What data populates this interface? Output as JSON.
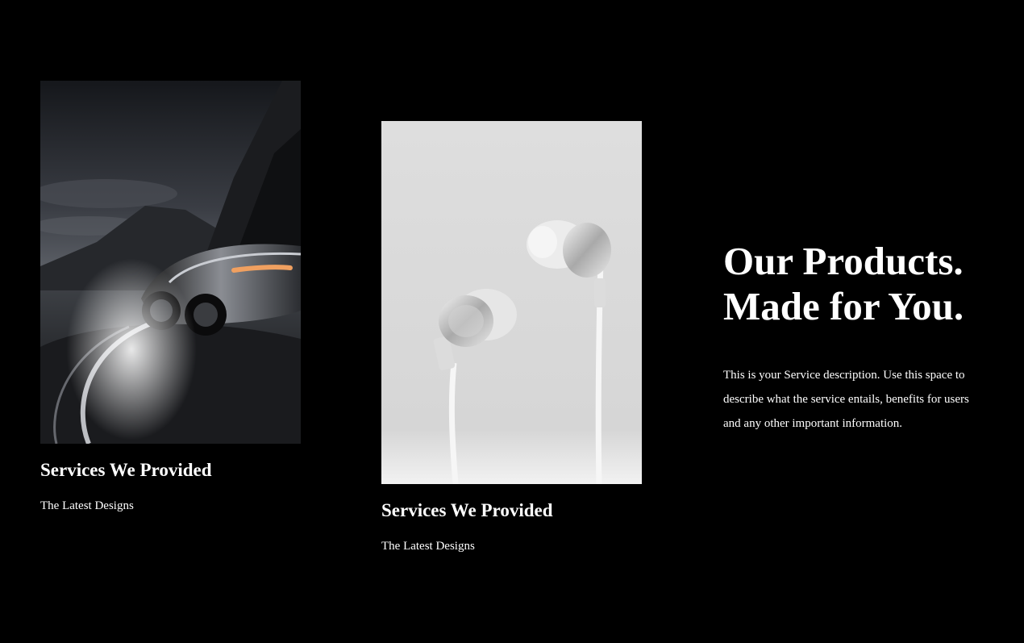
{
  "cards": [
    {
      "image_subject": "sports-car",
      "title": "Services We Provided",
      "subtitle": "The Latest Designs"
    },
    {
      "image_subject": "earphones",
      "title": "Services We Provided",
      "subtitle": "The Latest Designs"
    }
  ],
  "intro": {
    "headline_line1": "Our Products.",
    "headline_line2": "Made for You.",
    "description": "This is your Service description. Use this space to describe what the service entails, benefits for users and any other important information."
  },
  "colors": {
    "background": "#000000",
    "text": "#ffffff"
  }
}
